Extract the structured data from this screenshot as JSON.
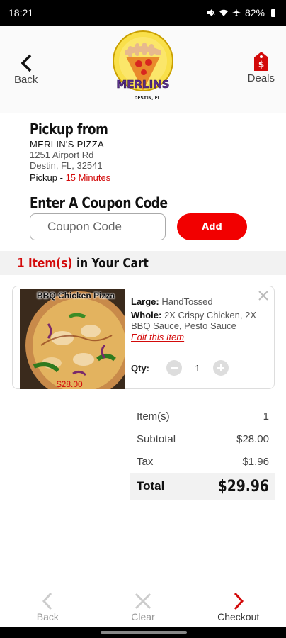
{
  "status_bar": {
    "time": "18:21",
    "battery": "82%"
  },
  "header": {
    "back_label": "Back",
    "deals_label": "Deals",
    "logo_text": "MERLINS",
    "logo_subtext": "DESTIN, FL"
  },
  "pickup": {
    "title": "Pickup from",
    "store_name": "MERLIN'S PIZZA",
    "address_line1": "1251 Airport Rd",
    "address_line2": "Destin, FL, 32541",
    "pickup_label": "Pickup - ",
    "pickup_time": "15 Minutes"
  },
  "coupon": {
    "title": "Enter A Coupon Code",
    "placeholder": "Coupon Code",
    "add_label": "Add"
  },
  "cart": {
    "count_text": "1 Item(s)",
    "label": "in Your Cart",
    "items": [
      {
        "name": "BBQ Chicken Pizza",
        "price": "$28.00",
        "size_key": "Large:",
        "size_value": "HandTossed",
        "whole_key": "Whole:",
        "whole_value": "2X Crispy Chicken, 2X BBQ Sauce, Pesto Sauce",
        "edit_label": "Edit this Item",
        "qty_label": "Qty:",
        "qty": "1"
      }
    ]
  },
  "totals": {
    "items_label": "Item(s)",
    "items_value": "1",
    "subtotal_label": "Subtotal",
    "subtotal_value": "$28.00",
    "tax_label": "Tax",
    "tax_value": "$1.96",
    "total_label": "Total",
    "total_value": "$29.96"
  },
  "bottom_nav": {
    "back_label": "Back",
    "clear_label": "Clear",
    "checkout_label": "Checkout"
  },
  "colors": {
    "accent_red": "#f20000",
    "text_red": "#d30a0a"
  },
  "icons": [
    "chevron-left-icon",
    "price-tag-icon",
    "close-icon",
    "minus-icon",
    "plus-icon",
    "chevron-right-icon"
  ]
}
